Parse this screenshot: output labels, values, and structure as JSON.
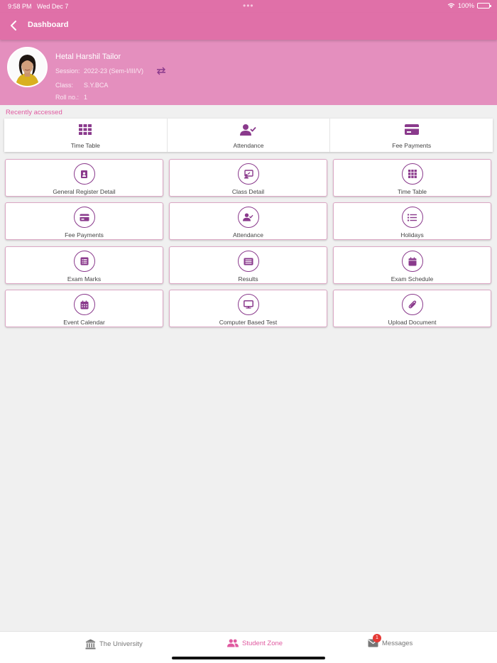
{
  "status": {
    "time": "9:58 PM",
    "date": "Wed Dec 7",
    "battery": "100%"
  },
  "nav": {
    "title": "Dashboard"
  },
  "profile": {
    "name": "Hetal Harshil Tailor",
    "session_label": "Session:",
    "session_value": "2022-23 (Sem-I/III/V)",
    "class_label": "Class:",
    "class_value": "S.Y.BCA",
    "roll_label": "Roll no.:",
    "roll_value": "1"
  },
  "recent": {
    "heading": "Recently accessed",
    "items": [
      {
        "label": "Time Table",
        "icon": "grid-icon"
      },
      {
        "label": "Attendance",
        "icon": "user-check-icon"
      },
      {
        "label": "Fee Payments",
        "icon": "credit-card-icon"
      }
    ]
  },
  "modules": [
    {
      "label": "General Register Detail",
      "icon": "contact-book-icon"
    },
    {
      "label": "Class Detail",
      "icon": "presentation-icon"
    },
    {
      "label": "Time Table",
      "icon": "grid-icon"
    },
    {
      "label": "Fee Payments",
      "icon": "credit-card-icon"
    },
    {
      "label": "Attendance",
      "icon": "user-check-icon"
    },
    {
      "label": "Holidays",
      "icon": "list-icon"
    },
    {
      "label": "Exam Marks",
      "icon": "list-box-icon"
    },
    {
      "label": "Results",
      "icon": "newspaper-icon"
    },
    {
      "label": "Exam Schedule",
      "icon": "calendar-icon"
    },
    {
      "label": "Event Calendar",
      "icon": "calendar-grid-icon"
    },
    {
      "label": "Computer Based Test",
      "icon": "monitor-icon"
    },
    {
      "label": "Upload Document",
      "icon": "paperclip-icon"
    }
  ],
  "tabs": [
    {
      "label": "The University",
      "icon": "university-icon"
    },
    {
      "label": "Student Zone",
      "icon": "people-icon"
    },
    {
      "label": "Messages",
      "icon": "mail-icon",
      "badge": "1"
    }
  ],
  "colors": {
    "primary": "#e070a8",
    "profile_bg": "#e48fbe",
    "icon": "#8a3a8c",
    "accent_text": "#e05aa0"
  }
}
